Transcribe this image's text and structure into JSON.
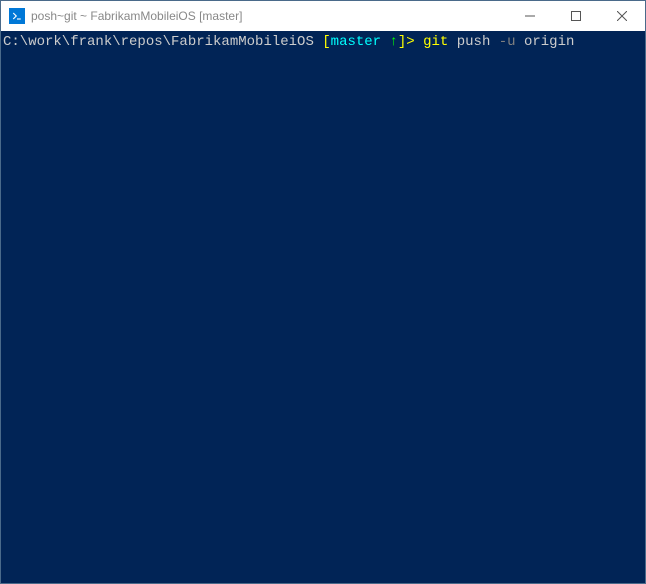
{
  "window": {
    "title": "posh~git ~ FabrikamMobileiOS [master]"
  },
  "terminal": {
    "prompt_path": "C:\\work\\frank\\repos\\FabrikamMobileiOS",
    "branch_open": " [",
    "branch_name": "master ",
    "branch_arrow": "↑",
    "branch_close": "]>",
    "space": " ",
    "cmd_git": "git",
    "cmd_push": "push",
    "cmd_flag": "-u",
    "cmd_origin": "origin"
  }
}
